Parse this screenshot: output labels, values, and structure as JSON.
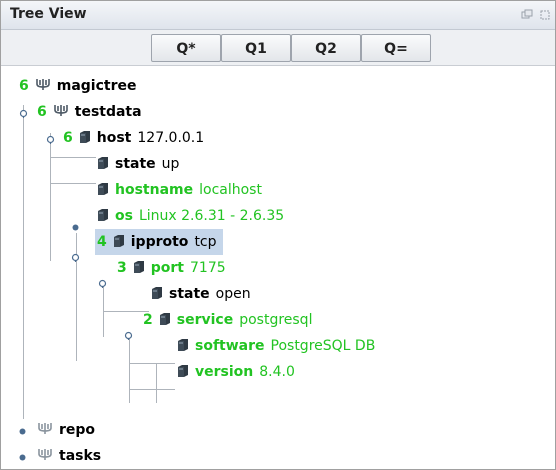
{
  "window": {
    "title": "Tree View",
    "icons": [
      "minimize-icon",
      "restore-icon"
    ]
  },
  "toolbar": {
    "buttons": [
      "Q*",
      "Q1",
      "Q2",
      "Q="
    ]
  },
  "tree": {
    "rows": [
      {
        "count": "6",
        "name": "magictree",
        "value": "",
        "icon": "fork-icon"
      },
      {
        "count": "6",
        "name": "testdata",
        "value": "",
        "icon": "fork-icon"
      },
      {
        "count": "6",
        "name": "host",
        "value": "127.0.0.1",
        "icon": "node-icon"
      },
      {
        "count": "",
        "name": "state",
        "value": "up",
        "icon": "node-icon"
      },
      {
        "count": "",
        "name": "hostname",
        "value": "localhost",
        "icon": "node-icon"
      },
      {
        "count": "",
        "name": "os",
        "value": "Linux 2.6.31 - 2.6.35",
        "icon": "node-icon"
      },
      {
        "count": "4",
        "name": "ipproto",
        "value": "tcp",
        "icon": "node-icon"
      },
      {
        "count": "3",
        "name": "port",
        "value": "7175",
        "icon": "node-icon"
      },
      {
        "count": "",
        "name": "state",
        "value": "open",
        "icon": "node-icon"
      },
      {
        "count": "2",
        "name": "service",
        "value": "postgresql",
        "icon": "node-icon"
      },
      {
        "count": "",
        "name": "software",
        "value": "PostgreSQL DB",
        "icon": "node-icon"
      },
      {
        "count": "",
        "name": "version",
        "value": "8.4.0",
        "icon": "node-icon"
      },
      {
        "count": "",
        "name": "repo",
        "value": "",
        "icon": "fork-icon"
      },
      {
        "count": "",
        "name": "tasks",
        "value": "",
        "icon": "fork-icon"
      }
    ]
  },
  "colors": {
    "green": "#22c322",
    "selection": "#c5d6ea",
    "titlebar": "#dfe4ec"
  }
}
